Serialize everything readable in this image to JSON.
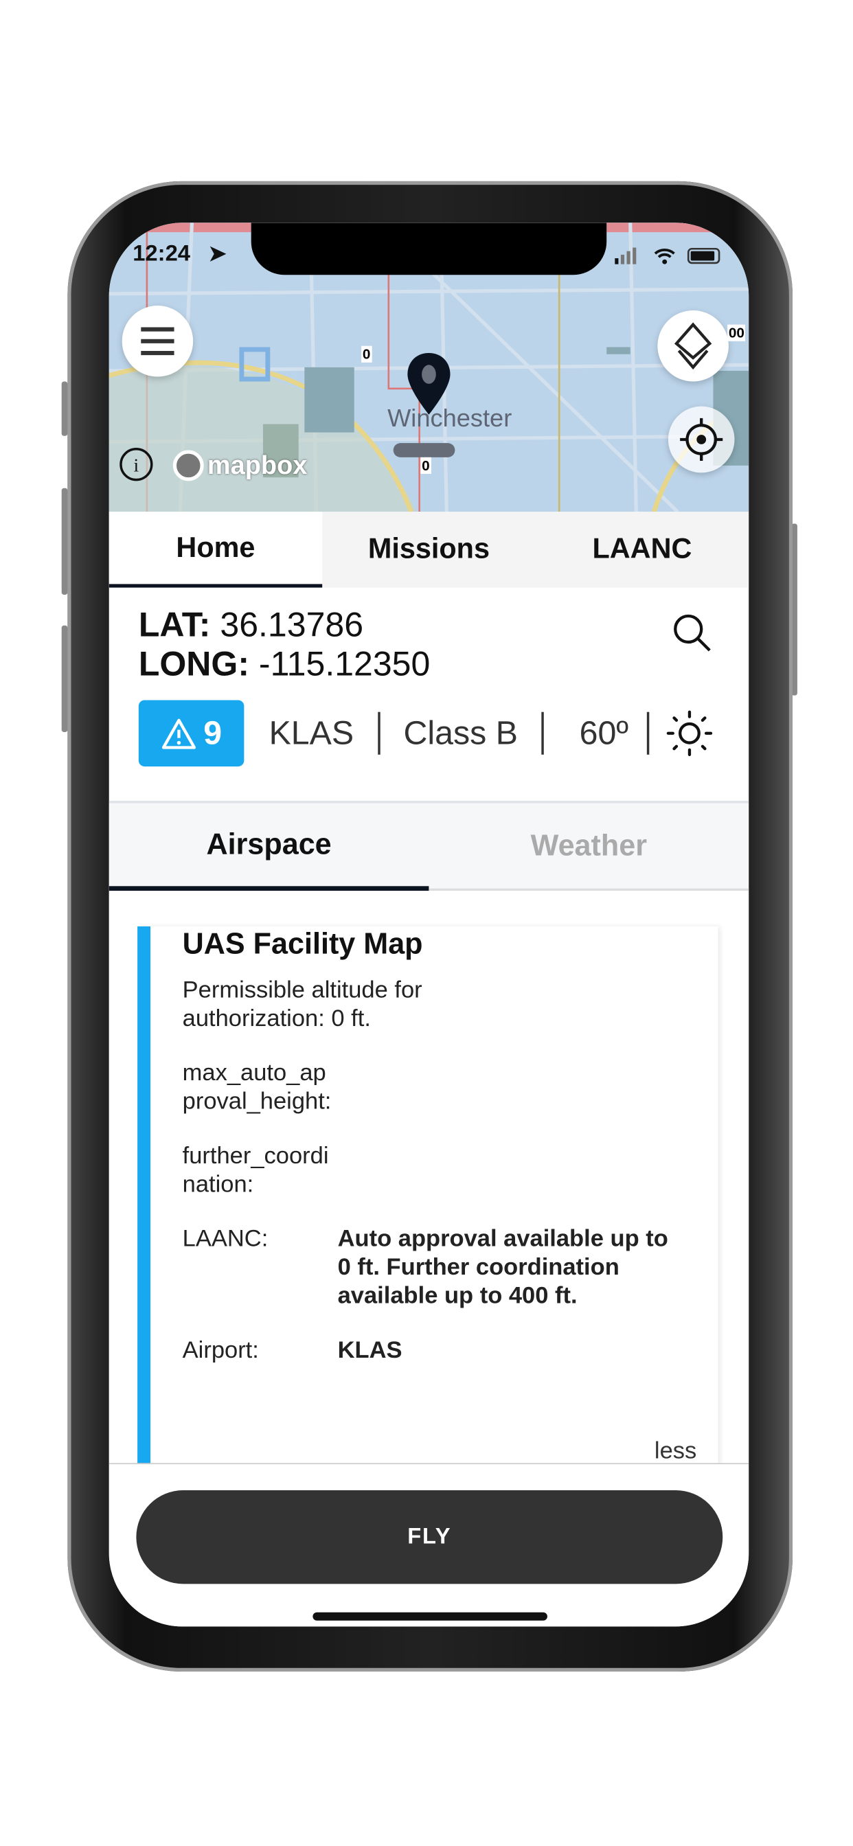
{
  "status_bar": {
    "time": "12:24"
  },
  "map": {
    "place_label": "Winchester",
    "altitude_labels": [
      "0",
      "0",
      "00"
    ],
    "attribution": "mapbox",
    "icons": [
      "menu-icon",
      "layers-icon",
      "locate-icon",
      "info-icon",
      "map-pin-icon"
    ]
  },
  "tabs": [
    {
      "label": "Home",
      "active": true
    },
    {
      "label": "Missions"
    },
    {
      "label": "LAANC"
    }
  ],
  "location": {
    "lat_label": "LAT:",
    "lat": "36.13786",
    "long_label": "LONG:",
    "long": "-115.12350"
  },
  "conditions": {
    "advisory_count": "9",
    "airport": "KLAS",
    "airspace_class": "Class B",
    "temperature": "60º",
    "weather_icon": "sun-icon",
    "accent": "#18a8f0"
  },
  "subtabs": [
    {
      "label": "Airspace",
      "active": true
    },
    {
      "label": "Weather"
    }
  ],
  "card": {
    "title": "UAS Facility Map",
    "description": "Permissible altitude for authorization: 0 ft.",
    "fields": [
      {
        "key": "max_auto_approval_height:",
        "value": ""
      },
      {
        "key": "further_coordination:",
        "value": ""
      },
      {
        "key": "LAANC:",
        "value": "Auto approval available up to 0 ft.  Further coordination available up to 400 ft."
      },
      {
        "key": "Airport:",
        "value": "KLAS"
      }
    ],
    "less_label": "less"
  },
  "fly_label": "FLY"
}
